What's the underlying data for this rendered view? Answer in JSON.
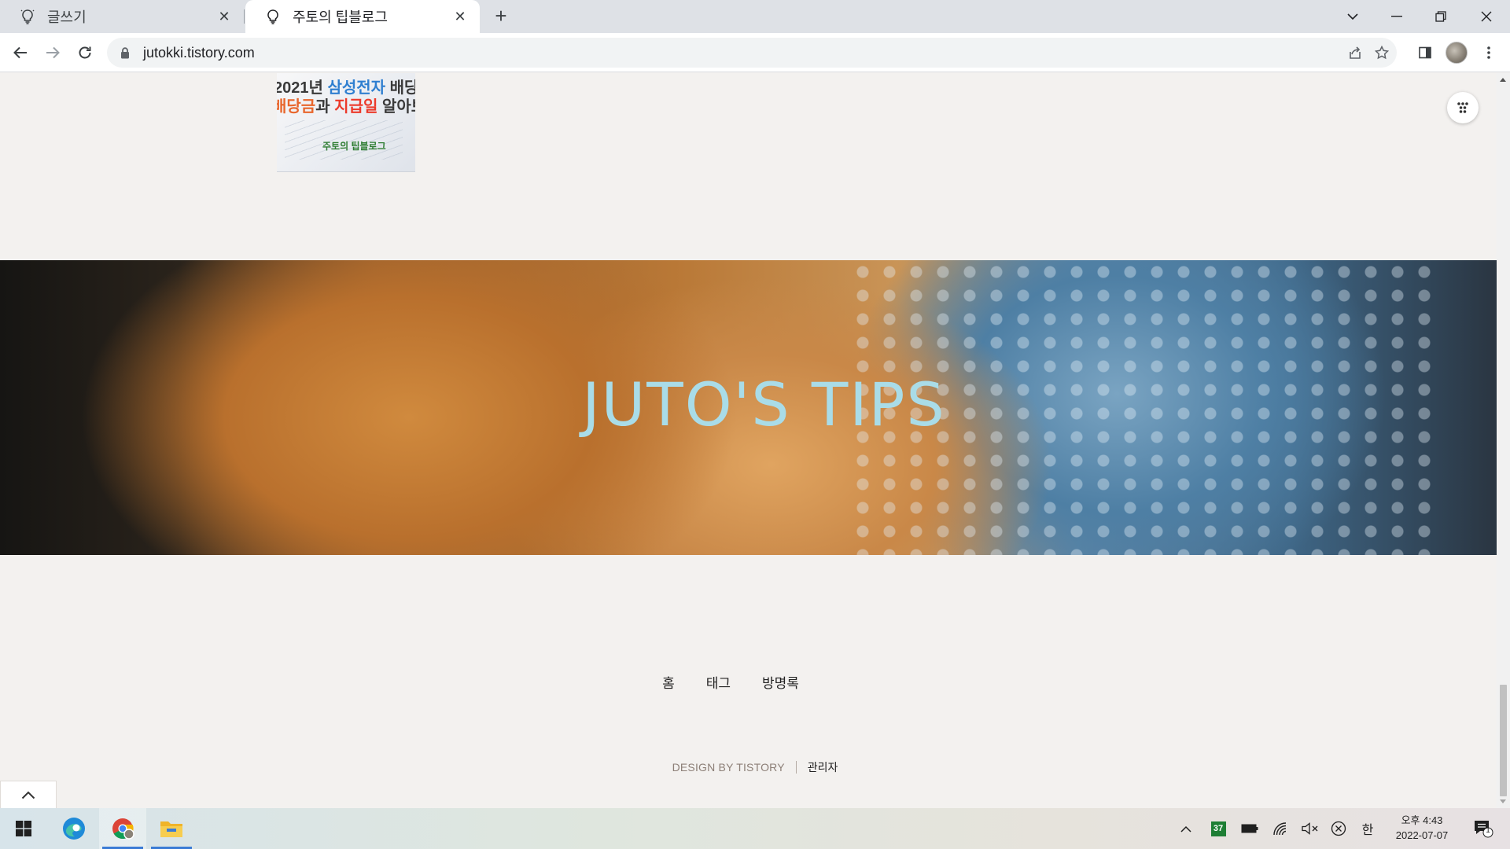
{
  "browser": {
    "tabs": [
      {
        "title": "글쓰기",
        "active": false
      },
      {
        "title": "주토의 팁블로그",
        "active": true
      }
    ],
    "address": "jutokki.tistory.com"
  },
  "page": {
    "thumbnail": {
      "line1_a": "2021년 ",
      "line1_b": "삼성전자",
      "line1_c": " 배당일",
      "line2_a": "배당금",
      "line2_b": "과 ",
      "line2_c": "지급일",
      "line2_d": " 알아보",
      "tag": "주토의 팁블로그"
    },
    "banner_title": "JUTO'S TIPS",
    "footer": {
      "nav": [
        "홈",
        "태그",
        "방명록"
      ],
      "design_credit": "DESIGN BY TISTORY",
      "admin_link": "관리자"
    }
  },
  "taskbar": {
    "tray_badge": "37",
    "ime": "한",
    "time": "오후 4:43",
    "date": "2022-07-07",
    "notification_count": "1"
  },
  "colors": {
    "page_bg": "#f3f1ef",
    "banner_title": "#a9dce8",
    "accent": "#3a7bd5"
  }
}
